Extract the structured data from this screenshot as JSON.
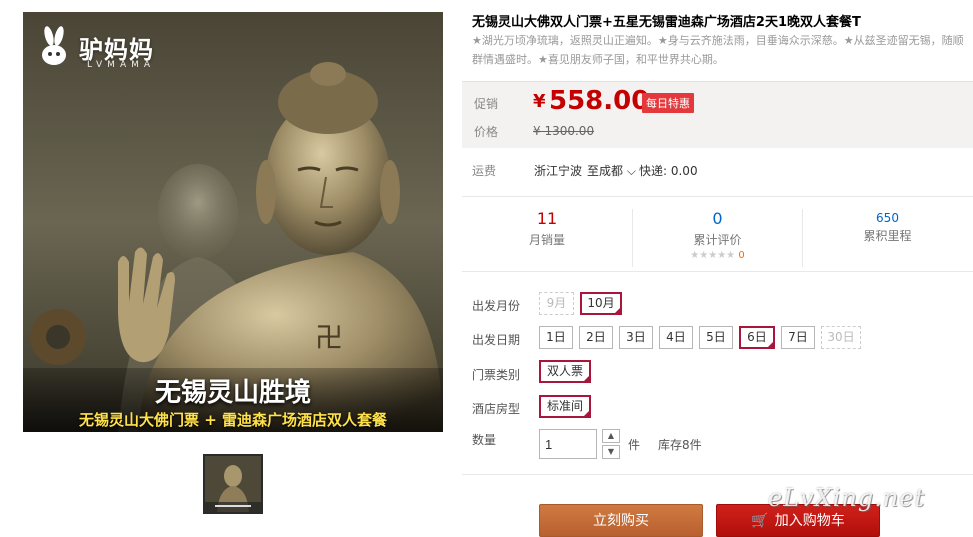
{
  "gallery": {
    "logo_text": "驴妈妈",
    "logo_sub": "LVMAMA",
    "caption_title": "无锡灵山胜境",
    "caption_sub": "无锡灵山大佛门票 + 雷迪森广场酒店双人套餐"
  },
  "product": {
    "title": "无锡灵山大佛双人门票+五星无锡雷迪森广场酒店2天1晚双人套餐T",
    "subtitle": "★湖光万顷净琉璃，返照灵山正遍知。★身与云齐施法雨，目垂诲众示深慈。★从兹圣迹留无锡，随顺群情遇盛时。★喜见朋友师子国，和平世界共心期。"
  },
  "price": {
    "promo_label": "促销",
    "currency": "¥",
    "promo_value": "558.00",
    "badge": "每日特惠",
    "price_label": "价格",
    "original": "¥ 1300.00"
  },
  "shipping": {
    "label": "运费",
    "from": "浙江宁波",
    "to": "至成都",
    "method": "快递: 0.00"
  },
  "stats": {
    "monthly_sales": "11",
    "monthly_sales_label": "月销量",
    "reviews": "0",
    "reviews_label": "累计评价",
    "stars": "★★★★★",
    "stars_count": "0",
    "mileage": "650",
    "mileage_label": "累积里程"
  },
  "sku": {
    "month_label": "出发月份",
    "months": [
      {
        "label": "9月",
        "state": "disabled"
      },
      {
        "label": "10月",
        "state": "selected"
      }
    ],
    "date_label": "出发日期",
    "dates": [
      {
        "label": "1日",
        "state": "normal"
      },
      {
        "label": "2日",
        "state": "normal"
      },
      {
        "label": "3日",
        "state": "normal"
      },
      {
        "label": "4日",
        "state": "normal"
      },
      {
        "label": "5日",
        "state": "normal"
      },
      {
        "label": "6日",
        "state": "selected"
      },
      {
        "label": "7日",
        "state": "normal"
      },
      {
        "label": "30日",
        "state": "disabled"
      }
    ],
    "ticket_label": "门票类别",
    "ticket_value": "双人票",
    "room_label": "酒店房型",
    "room_value": "标准间"
  },
  "quantity": {
    "label": "数量",
    "value": "1",
    "unit": "件",
    "stock": "库存8件"
  },
  "actions": {
    "buy_now": "立刻购买",
    "add_cart": "加入购物车"
  },
  "watermark": "eLvXing.net",
  "colors": {
    "price_red": "#c40000",
    "selected_border": "#a8163c",
    "buy_button": "#c06a38",
    "cart_button": "#c3150f",
    "link_blue": "#0066cc"
  }
}
